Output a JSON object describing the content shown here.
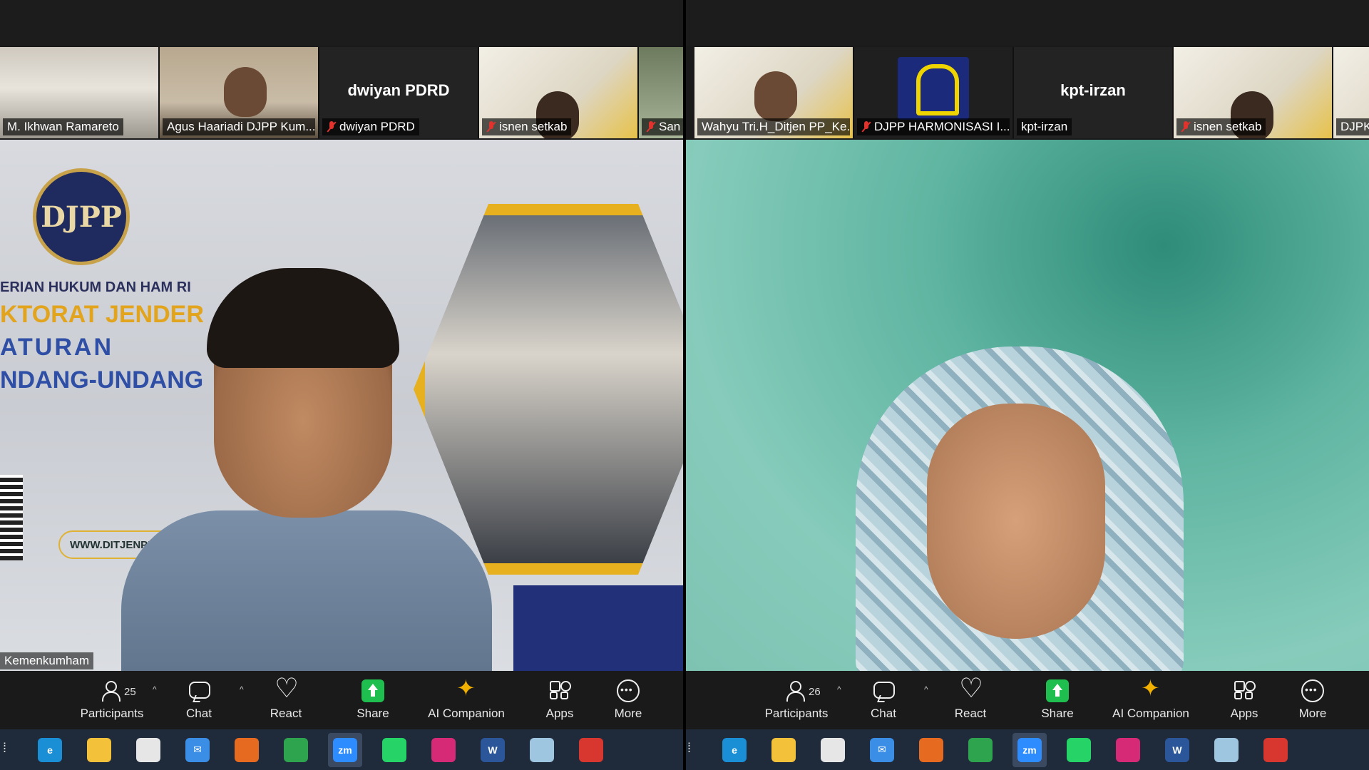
{
  "left": {
    "thumbnails": [
      {
        "label": "M. Ikhwan Ramareto",
        "big_name": "",
        "muted": false,
        "bg": "room"
      },
      {
        "label": "Agus Haariadi DJPP Kum...",
        "big_name": "",
        "muted": false,
        "bg": "office"
      },
      {
        "label": "dwiyan PDRD",
        "big_name": "dwiyan PDRD",
        "muted": true,
        "bg": "blank"
      },
      {
        "label": "isnen setkab",
        "big_name": "",
        "muted": true,
        "bg": "banner"
      },
      {
        "label": "San",
        "big_name": "",
        "muted": true,
        "bg": "green"
      }
    ],
    "slide": {
      "logo_text": "DJPP",
      "line1": "ERIAN HUKUM DAN HAM RI",
      "line2": "KTORAT JENDER",
      "line3": "ATURAN",
      "line4": "NDANG-UNDANG",
      "url": "WWW.DITJENPP.KEMENKUMHAM.G"
    },
    "name_tag": "Kemenkumham",
    "participants_count": "25"
  },
  "right": {
    "thumbnails": [
      {
        "label": "Wahyu Tri.H_Ditjen PP_Ke...",
        "big_name": "",
        "muted": false,
        "bg": "banner"
      },
      {
        "label": "DJPP HARMONISASI I...",
        "big_name": "",
        "muted": true,
        "bg": "logo"
      },
      {
        "label": "kpt-irzan",
        "big_name": "kpt-irzan",
        "muted": false,
        "bg": "blank"
      },
      {
        "label": "isnen setkab",
        "big_name": "",
        "muted": true,
        "bg": "banner"
      },
      {
        "label": "DJPK",
        "big_name": "",
        "muted": false,
        "bg": "banner"
      }
    ],
    "participants_count": "26"
  },
  "toolbar": {
    "participants": "Participants",
    "chat": "Chat",
    "react": "React",
    "share": "Share",
    "ai_companion": "AI Companion",
    "apps": "Apps",
    "more": "More"
  },
  "taskbar": {
    "apps": [
      {
        "name": "edge-icon",
        "color": "#1b8fd6",
        "glyph": "e"
      },
      {
        "name": "file-explorer-icon",
        "color": "#f3c13a",
        "glyph": ""
      },
      {
        "name": "store-icon",
        "color": "#e6e6e6",
        "glyph": ""
      },
      {
        "name": "mail-icon",
        "color": "#3a8ee6",
        "glyph": "✉"
      },
      {
        "name": "firefox-icon",
        "color": "#e66a1f",
        "glyph": ""
      },
      {
        "name": "chrome-icon",
        "color": "#2ea44f",
        "glyph": ""
      },
      {
        "name": "zoom-icon",
        "color": "#2d8cff",
        "glyph": "zm",
        "active": true
      },
      {
        "name": "whatsapp-icon",
        "color": "#25d366",
        "glyph": ""
      },
      {
        "name": "instagram-icon",
        "color": "#d62976",
        "glyph": ""
      },
      {
        "name": "word-icon",
        "color": "#2b579a",
        "glyph": "W"
      },
      {
        "name": "notes-icon",
        "color": "#9fc6e0",
        "glyph": ""
      },
      {
        "name": "acrobat-icon",
        "color": "#d7372f",
        "glyph": ""
      }
    ]
  }
}
